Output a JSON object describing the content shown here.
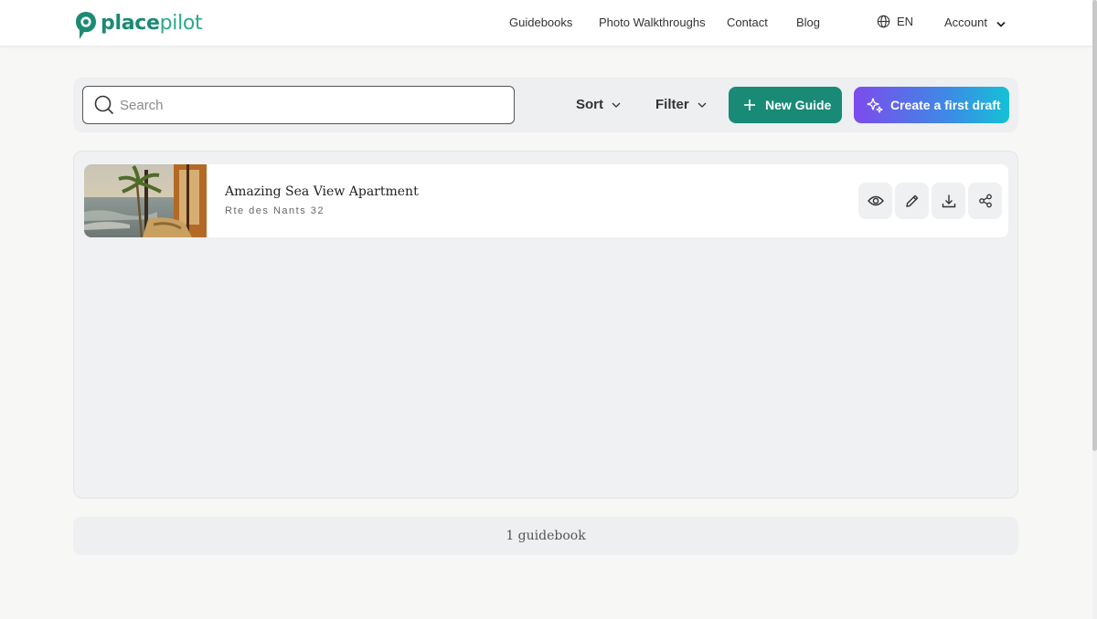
{
  "brand": {
    "name_bold": "place",
    "name_light": "pilot",
    "color": "#1c8a74"
  },
  "nav": {
    "items": [
      "Guidebooks",
      "Photo Walkthroughs",
      "Contact",
      "Blog"
    ],
    "language": "EN",
    "account": "Account"
  },
  "toolbar": {
    "search_placeholder": "Search",
    "search_value": "",
    "sort_label": "Sort",
    "filter_label": "Filter",
    "new_guide_label": "New Guide",
    "create_draft_label": "Create a first draft"
  },
  "guidebooks": [
    {
      "title": "Amazing Sea View Apartment",
      "address": "Rte des Nants 32",
      "actions": [
        "eye-icon",
        "pencil-icon",
        "download-icon",
        "share-icon"
      ]
    }
  ],
  "footer": {
    "count_label": "1 guidebook"
  },
  "colors": {
    "accent": "#198a76",
    "gradient_start": "#7d4bec",
    "gradient_end": "#14c1d6"
  }
}
